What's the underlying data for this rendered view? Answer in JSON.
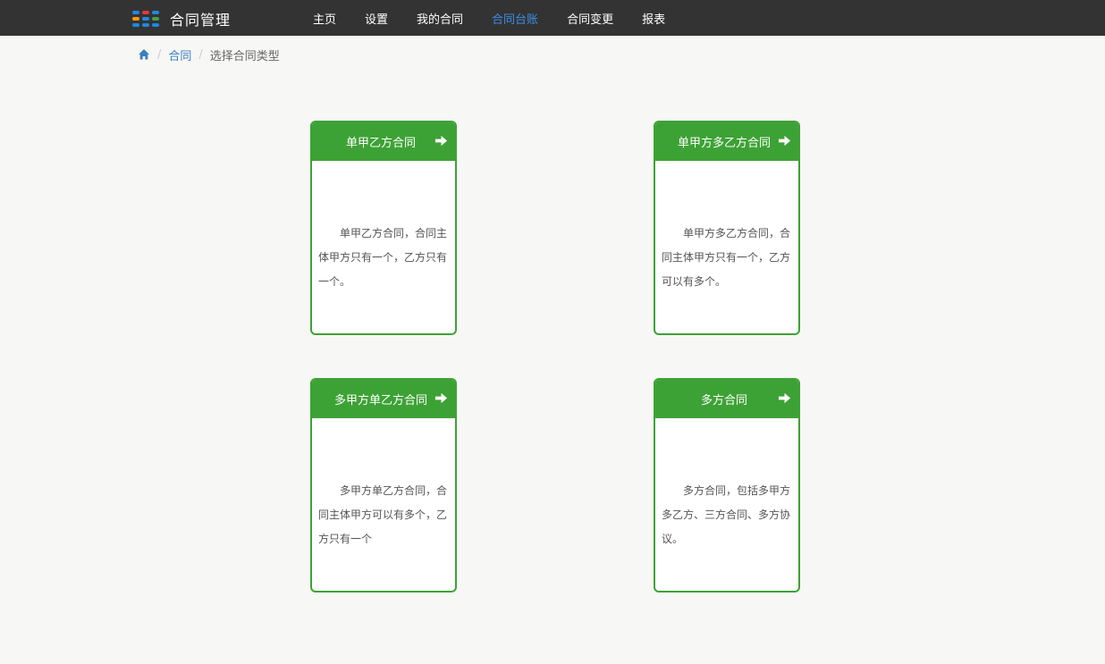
{
  "app": {
    "title": "合同管理",
    "logo_colors": [
      "#1e88e5",
      "#e53935",
      "#1e88e5",
      "#ff9800",
      "#1e88e5",
      "#43a047",
      "#1e88e5",
      "#1e88e5",
      "#1e88e5"
    ]
  },
  "nav": {
    "items": [
      {
        "label": "主页",
        "active": false
      },
      {
        "label": "设置",
        "active": false
      },
      {
        "label": "我的合同",
        "active": false
      },
      {
        "label": "合同台账",
        "active": true
      },
      {
        "label": "合同变更",
        "active": false
      },
      {
        "label": "报表",
        "active": false
      }
    ]
  },
  "breadcrumb": {
    "home_icon": "home-icon",
    "link": "合同",
    "current": "选择合同类型"
  },
  "cards": [
    {
      "title": "单甲乙方合同",
      "desc": "单甲乙方合同，合同主体甲方只有一个，乙方只有一个。",
      "icon": "arrow-right-icon"
    },
    {
      "title": "单甲方多乙方合同",
      "desc": "单甲方多乙方合同，合同主体甲方只有一个，乙方可以有多个。",
      "icon": "arrow-right-icon"
    },
    {
      "title": "多甲方单乙方合同",
      "desc": "多甲方单乙方合同，合同主体甲方可以有多个，乙方只有一个",
      "icon": "arrow-right-icon"
    },
    {
      "title": "多方合同",
      "desc": "多方合同，包括多甲方多乙方、三方合同、多方协议。",
      "icon": "arrow-right-icon"
    }
  ],
  "colors": {
    "topbar": "#333333",
    "accent_green": "#3da235",
    "active_nav": "#3a8ee6",
    "link": "#3a7fc4"
  }
}
